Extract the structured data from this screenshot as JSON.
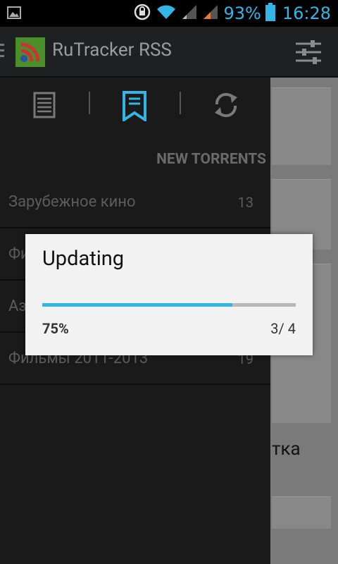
{
  "status_bar": {
    "battery": "93%",
    "time": "16:28"
  },
  "app": {
    "title": "RuTracker RSS"
  },
  "drawer": {
    "section_header": "NEW TORRENTS",
    "items": [
      {
        "label": "Зарубежное кино",
        "count": "13"
      },
      {
        "label": "Фи",
        "count": ""
      },
      {
        "label": "Аз",
        "count": ""
      },
      {
        "label": "Фильмы 2011-2013",
        "count": "19"
      }
    ]
  },
  "background": {
    "visible_text": "тка"
  },
  "dialog": {
    "title": "Updating",
    "progress_fraction": 0.75,
    "percent": "75%",
    "count": "3/ 4"
  },
  "colors": {
    "accent": "#33b5e5",
    "drawer_selected_tab": "#33b5e5"
  }
}
